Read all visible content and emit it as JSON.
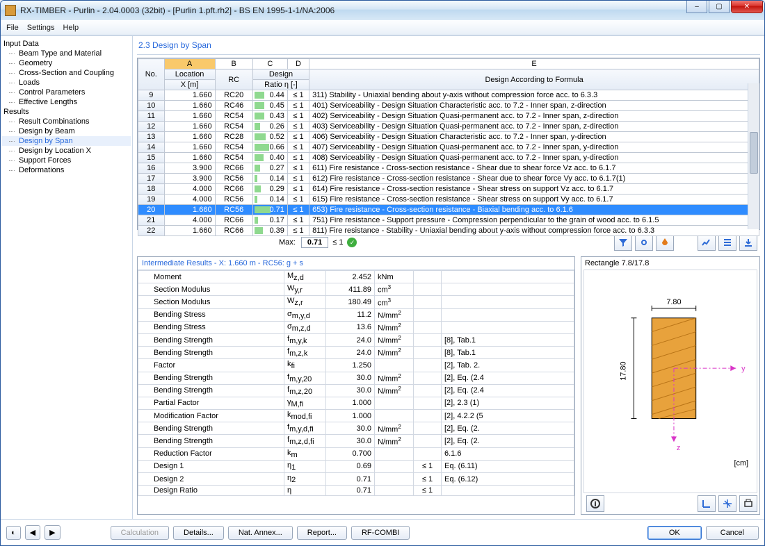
{
  "title": "RX-TIMBER - Purlin - 2.04.0003 (32bit) - [Purlin 1.pft.rh2] - BS EN 1995-1-1/NA:2006",
  "menu": {
    "file": "File",
    "settings": "Settings",
    "help": "Help"
  },
  "tree": {
    "input": "Input Data",
    "input_items": [
      "Beam Type and Material",
      "Geometry",
      "Cross-Section and Coupling",
      "Loads",
      "Control Parameters",
      "Effective Lengths"
    ],
    "results": "Results",
    "result_items": [
      "Result Combinations",
      "Design by Beam",
      "Design by Span",
      "Design by Location X",
      "Support Forces",
      "Deformations"
    ],
    "selected": "Design by Span"
  },
  "section_title": "2.3 Design by Span",
  "letters": [
    "A",
    "B",
    "C",
    "D",
    "E"
  ],
  "headers": {
    "no": "No.",
    "loc": "Location",
    "x": "X [m]",
    "rc": "RC",
    "design": "Design",
    "ratio": "Ratio η [-]",
    "formula": "Design According to Formula"
  },
  "rows": [
    {
      "no": 9,
      "x": "1.660",
      "rc": "RC20",
      "ratio": "0.44",
      "cmp": "≤ 1",
      "desc": "311) Stability - Uniaxial bending about y-axis without compression force acc. to 6.3.3",
      "bar": 44
    },
    {
      "no": 10,
      "x": "1.660",
      "rc": "RC46",
      "ratio": "0.45",
      "cmp": "≤ 1",
      "desc": "401) Serviceability - Design Situation Characteristic acc. to 7.2 - Inner span, z-direction",
      "bar": 45
    },
    {
      "no": 11,
      "x": "1.660",
      "rc": "RC54",
      "ratio": "0.43",
      "cmp": "≤ 1",
      "desc": "402) Serviceability - Design Situation Quasi-permanent acc. to 7.2 - Inner span, z-direction",
      "bar": 43
    },
    {
      "no": 12,
      "x": "1.660",
      "rc": "RC54",
      "ratio": "0.26",
      "cmp": "≤ 1",
      "desc": "403) Serviceability - Design Situation Quasi-permanent acc. to 7.2 - Inner span, z-direction",
      "bar": 26
    },
    {
      "no": 13,
      "x": "1.660",
      "rc": "RC28",
      "ratio": "0.52",
      "cmp": "≤ 1",
      "desc": "406) Serviceability - Design Situation Characteristic acc. to 7.2 - Inner span, y-direction",
      "bar": 52
    },
    {
      "no": 14,
      "x": "1.660",
      "rc": "RC54",
      "ratio": "0.66",
      "cmp": "≤ 1",
      "desc": "407) Serviceability - Design Situation Quasi-permanent acc. to 7.2 - Inner span, y-direction",
      "bar": 66
    },
    {
      "no": 15,
      "x": "1.660",
      "rc": "RC54",
      "ratio": "0.40",
      "cmp": "≤ 1",
      "desc": "408) Serviceability - Design Situation Quasi-permanent acc. to 7.2 - Inner span, y-direction",
      "bar": 40
    },
    {
      "no": 16,
      "x": "3.900",
      "rc": "RC66",
      "ratio": "0.27",
      "cmp": "≤ 1",
      "desc": "611) Fire resistance - Cross-section resistance - Shear due to shear force Vz acc. to 6.1.7",
      "bar": 27
    },
    {
      "no": 17,
      "x": "3.900",
      "rc": "RC56",
      "ratio": "0.14",
      "cmp": "≤ 1",
      "desc": "612) Fire resistance - Cross-section resistance - Shear due to shear force Vy acc. to 6.1.7(1)",
      "bar": 14
    },
    {
      "no": 18,
      "x": "4.000",
      "rc": "RC66",
      "ratio": "0.29",
      "cmp": "≤ 1",
      "desc": "614) Fire resistance - Cross-section resistance - Shear stress on support Vz acc. to 6.1.7",
      "bar": 29
    },
    {
      "no": 19,
      "x": "4.000",
      "rc": "RC56",
      "ratio": "0.14",
      "cmp": "≤ 1",
      "desc": "615) Fire resistance - Cross-section resistance - Shear stress on support Vy acc. to 6.1.7",
      "bar": 14
    },
    {
      "no": 20,
      "x": "1.660",
      "rc": "RC56",
      "ratio": "0.71",
      "cmp": "≤ 1",
      "desc": "653) Fire resistance - Cross-section resistance - Biaxial bending acc. to 6.1.6",
      "bar": 71,
      "sel": true
    },
    {
      "no": 21,
      "x": "4.000",
      "rc": "RC66",
      "ratio": "0.17",
      "cmp": "≤ 1",
      "desc": "751) Fire resistance - Support pressure - Compression perpendicular to the grain of wood acc. to 6.1.5",
      "bar": 17
    },
    {
      "no": 22,
      "x": "1.660",
      "rc": "RC66",
      "ratio": "0.39",
      "cmp": "≤ 1",
      "desc": "811) Fire resistance - Stability - Uniaxial bending about y-axis without compression force acc. to 6.3.3",
      "bar": 39
    }
  ],
  "max": {
    "label": "Max:",
    "value": "0.71",
    "cmp": "≤ 1"
  },
  "inter_title": "Intermediate Results  -  X: 1.660 m  -  RC56: g + s",
  "inter_rows": [
    {
      "k": "Moment",
      "s": "M<sub>z,d</sub>",
      "v": "2.452",
      "u": "kNm",
      "c": "",
      "r": ""
    },
    {
      "k": "Section Modulus",
      "s": "W<sub>y,r</sub>",
      "v": "411.89",
      "u": "cm<sup>3</sup>",
      "c": "",
      "r": ""
    },
    {
      "k": "Section Modulus",
      "s": "W<sub>z,r</sub>",
      "v": "180.49",
      "u": "cm<sup>3</sup>",
      "c": "",
      "r": ""
    },
    {
      "k": "Bending Stress",
      "s": "σ<sub>m,y,d</sub>",
      "v": "11.2",
      "u": "N/mm<sup>2</sup>",
      "c": "",
      "r": ""
    },
    {
      "k": "Bending Stress",
      "s": "σ<sub>m,z,d</sub>",
      "v": "13.6",
      "u": "N/mm<sup>2</sup>",
      "c": "",
      "r": ""
    },
    {
      "k": "Bending Strength",
      "s": "f<sub>m,y,k</sub>",
      "v": "24.0",
      "u": "N/mm<sup>2</sup>",
      "c": "",
      "r": "[8], Tab.1"
    },
    {
      "k": "Bending Strength",
      "s": "f<sub>m,z,k</sub>",
      "v": "24.0",
      "u": "N/mm<sup>2</sup>",
      "c": "",
      "r": "[8], Tab.1"
    },
    {
      "k": "Factor",
      "s": "k<sub>fi</sub>",
      "v": "1.250",
      "u": "",
      "c": "",
      "r": "[2], Tab. 2."
    },
    {
      "k": "Bending Strength",
      "s": "f<sub>m,y,20</sub>",
      "v": "30.0",
      "u": "N/mm<sup>2</sup>",
      "c": "",
      "r": "[2], Eq. (2.4"
    },
    {
      "k": "Bending Strength",
      "s": "f<sub>m,z,20</sub>",
      "v": "30.0",
      "u": "N/mm<sup>2</sup>",
      "c": "",
      "r": "[2], Eq. (2.4"
    },
    {
      "k": "Partial Factor",
      "s": "γ<sub>M,fi</sub>",
      "v": "1.000",
      "u": "",
      "c": "",
      "r": "[2], 2.3 (1)"
    },
    {
      "k": "Modification Factor",
      "s": "k<sub>mod,fi</sub>",
      "v": "1.000",
      "u": "",
      "c": "",
      "r": "[2], 4.2.2 (5"
    },
    {
      "k": "Bending Strength",
      "s": "f<sub>m,y,d,fi</sub>",
      "v": "30.0",
      "u": "N/mm<sup>2</sup>",
      "c": "",
      "r": "[2], Eq. (2."
    },
    {
      "k": "Bending Strength",
      "s": "f<sub>m,z,d,fi</sub>",
      "v": "30.0",
      "u": "N/mm<sup>2</sup>",
      "c": "",
      "r": "[2], Eq. (2."
    },
    {
      "k": "Reduction Factor",
      "s": "k<sub>m</sub>",
      "v": "0.700",
      "u": "",
      "c": "",
      "r": "6.1.6"
    },
    {
      "k": "Design 1",
      "s": "η<sub>1</sub>",
      "v": "0.69",
      "u": "",
      "c": "≤ 1",
      "r": "Eq. (6.11)"
    },
    {
      "k": "Design 2",
      "s": "η<sub>2</sub>",
      "v": "0.71",
      "u": "",
      "c": "≤ 1",
      "r": "Eq. (6.12)"
    },
    {
      "k": "Design Ratio",
      "s": "η",
      "v": "0.71",
      "u": "",
      "c": "≤ 1",
      "r": ""
    }
  ],
  "section_view": {
    "title": "Rectangle 7.8/17.8",
    "w": "7.80",
    "h": "17.80",
    "unit": "[cm]",
    "y": "y",
    "z": "z"
  },
  "chart_data": {
    "type": "table",
    "note": "Cross-section rectangle 7.80 × 17.80 cm"
  },
  "buttons": {
    "calc": "Calculation",
    "details": "Details...",
    "annex": "Nat. Annex...",
    "report": "Report...",
    "combi": "RF-COMBI",
    "ok": "OK",
    "cancel": "Cancel"
  }
}
